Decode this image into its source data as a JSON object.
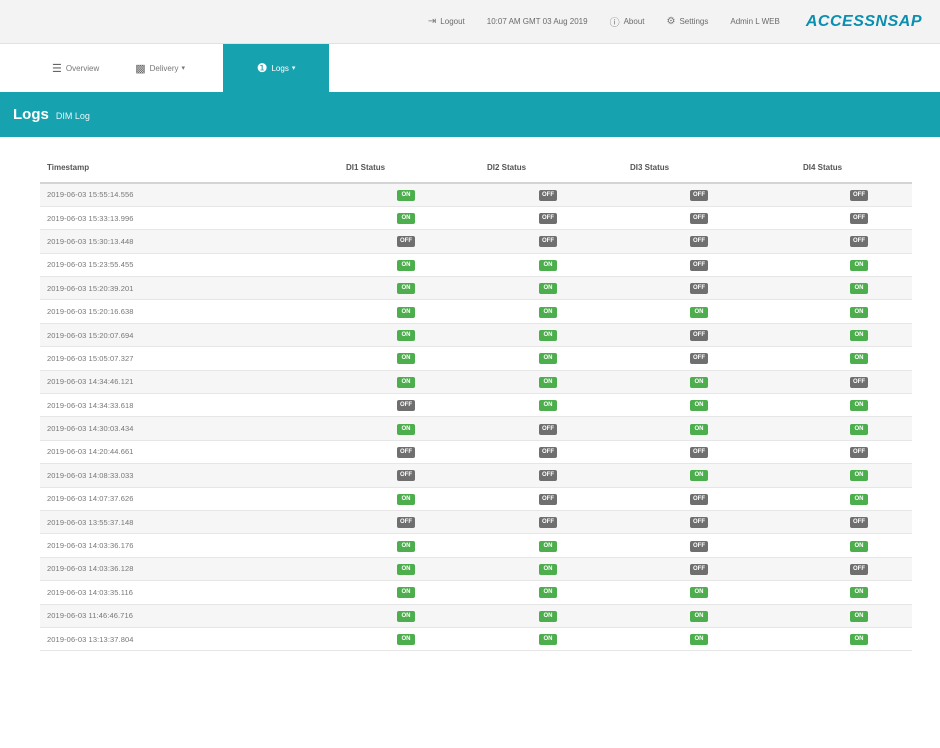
{
  "header": {
    "logout_label": "Logout",
    "datetime": "10:07 AM GMT 03 Aug 2019",
    "about_label": "About",
    "settings_label": "Settings",
    "user": "Admin L WEB",
    "logo": "ACCESSNSAP"
  },
  "nav": {
    "tabs": [
      {
        "label": "Overview"
      },
      {
        "label": "Delivery"
      },
      {
        "label": "Logs"
      }
    ]
  },
  "page": {
    "title": "Logs",
    "subtitle": "DIM Log"
  },
  "table": {
    "columns": [
      "Timestamp",
      "DI1 Status",
      "DI2 Status",
      "DI3 Status",
      "DI4 Status"
    ],
    "on_label": "ON",
    "off_label": "OFF",
    "rows": [
      {
        "ts": "2019-06-03 15:55:14.556",
        "s": [
          "ON",
          "OFF",
          "OFF",
          "OFF"
        ]
      },
      {
        "ts": "2019-06-03 15:33:13.996",
        "s": [
          "ON",
          "OFF",
          "OFF",
          "OFF"
        ]
      },
      {
        "ts": "2019-06-03 15:30:13.448",
        "s": [
          "OFF",
          "OFF",
          "OFF",
          "OFF"
        ]
      },
      {
        "ts": "2019-06-03 15:23:55.455",
        "s": [
          "ON",
          "ON",
          "OFF",
          "ON"
        ]
      },
      {
        "ts": "2019-06-03 15:20:39.201",
        "s": [
          "ON",
          "ON",
          "OFF",
          "ON"
        ]
      },
      {
        "ts": "2019-06-03 15:20:16.638",
        "s": [
          "ON",
          "ON",
          "ON",
          "ON"
        ]
      },
      {
        "ts": "2019-06-03 15:20:07.694",
        "s": [
          "ON",
          "ON",
          "OFF",
          "ON"
        ]
      },
      {
        "ts": "2019-06-03 15:05:07.327",
        "s": [
          "ON",
          "ON",
          "OFF",
          "ON"
        ]
      },
      {
        "ts": "2019-06-03 14:34:46.121",
        "s": [
          "ON",
          "ON",
          "ON",
          "OFF"
        ]
      },
      {
        "ts": "2019-06-03 14:34:33.618",
        "s": [
          "OFF",
          "ON",
          "ON",
          "ON"
        ]
      },
      {
        "ts": "2019-06-03 14:30:03.434",
        "s": [
          "ON",
          "OFF",
          "ON",
          "ON"
        ]
      },
      {
        "ts": "2019-06-03 14:20:44.661",
        "s": [
          "OFF",
          "OFF",
          "OFF",
          "OFF"
        ]
      },
      {
        "ts": "2019-06-03 14:08:33.033",
        "s": [
          "OFF",
          "OFF",
          "ON",
          "ON"
        ]
      },
      {
        "ts": "2019-06-03 14:07:37.626",
        "s": [
          "ON",
          "OFF",
          "OFF",
          "ON"
        ]
      },
      {
        "ts": "2019-06-03 13:55:37.148",
        "s": [
          "OFF",
          "OFF",
          "OFF",
          "OFF"
        ]
      },
      {
        "ts": "2019-06-03 14:03:36.176",
        "s": [
          "ON",
          "ON",
          "OFF",
          "ON"
        ]
      },
      {
        "ts": "2019-06-03 14:03:36.128",
        "s": [
          "ON",
          "ON",
          "OFF",
          "OFF"
        ]
      },
      {
        "ts": "2019-06-03 14:03:35.116",
        "s": [
          "ON",
          "ON",
          "ON",
          "ON"
        ]
      },
      {
        "ts": "2019-06-03 11:46:46.716",
        "s": [
          "ON",
          "ON",
          "ON",
          "ON"
        ]
      },
      {
        "ts": "2019-06-03 13:13:37.804",
        "s": [
          "ON",
          "ON",
          "ON",
          "ON"
        ]
      }
    ]
  },
  "colors": {
    "accent": "#17a2b0",
    "on": "#4cae4c",
    "off": "#6f6f6f"
  }
}
